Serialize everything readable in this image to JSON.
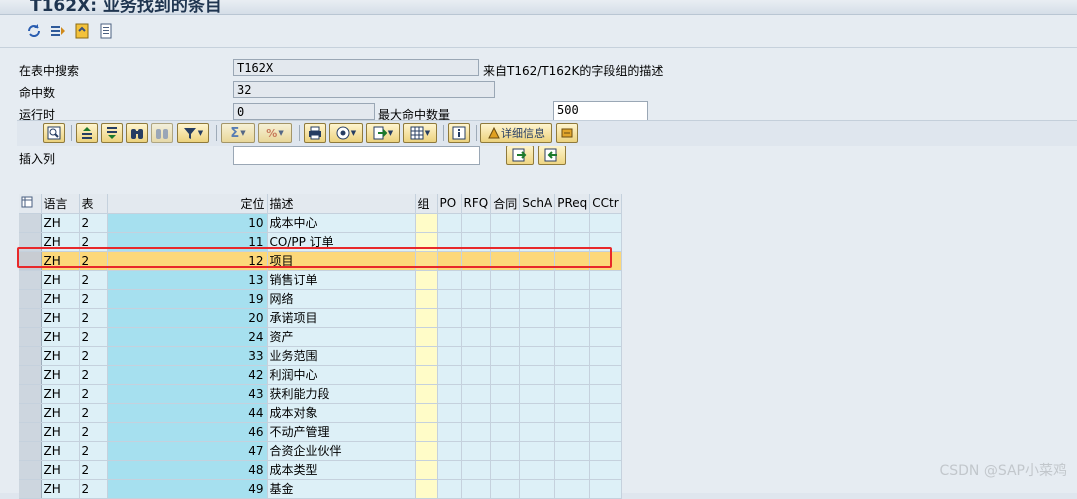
{
  "window": {
    "title": "T162X: 业务找到的条目"
  },
  "toolbar": {
    "icons": [
      "refresh-icon",
      "fieldlist-icon",
      "mark-icon",
      "documentation-icon"
    ]
  },
  "selection": {
    "search_label": "在表中搜索",
    "search_value": "T162X",
    "search_desc": "来自T162/T162K的字段组的描述",
    "hits_label": "命中数",
    "hits_value": "32",
    "runtime_label": "运行时",
    "runtime_value": "0",
    "maxhits_label": "最大命中数量",
    "maxhits_value": "500",
    "insert_col_label": "插入列",
    "insert_col_value": ""
  },
  "alv_toolbar": {
    "details_label": "详细信息"
  },
  "grid": {
    "columns": [
      "语言",
      "表",
      "定位",
      "描述",
      "组",
      "PO",
      "RFQ",
      "合同",
      "SchA",
      "PReq",
      "CCtr"
    ],
    "rows": [
      {
        "lang": "ZH",
        "tab": "2",
        "pos": "10",
        "desc": "成本中心"
      },
      {
        "lang": "ZH",
        "tab": "2",
        "pos": "11",
        "desc": "CO/PP 订单"
      },
      {
        "lang": "ZH",
        "tab": "2",
        "pos": "12",
        "desc": "项目"
      },
      {
        "lang": "ZH",
        "tab": "2",
        "pos": "13",
        "desc": "销售订单"
      },
      {
        "lang": "ZH",
        "tab": "2",
        "pos": "19",
        "desc": "网络"
      },
      {
        "lang": "ZH",
        "tab": "2",
        "pos": "20",
        "desc": "承诺项目"
      },
      {
        "lang": "ZH",
        "tab": "2",
        "pos": "24",
        "desc": "资产"
      },
      {
        "lang": "ZH",
        "tab": "2",
        "pos": "33",
        "desc": "业务范围"
      },
      {
        "lang": "ZH",
        "tab": "2",
        "pos": "42",
        "desc": "利润中心"
      },
      {
        "lang": "ZH",
        "tab": "2",
        "pos": "43",
        "desc": "获利能力段"
      },
      {
        "lang": "ZH",
        "tab": "2",
        "pos": "44",
        "desc": "成本对象"
      },
      {
        "lang": "ZH",
        "tab": "2",
        "pos": "46",
        "desc": "不动产管理"
      },
      {
        "lang": "ZH",
        "tab": "2",
        "pos": "47",
        "desc": "合资企业伙伴"
      },
      {
        "lang": "ZH",
        "tab": "2",
        "pos": "48",
        "desc": "成本类型"
      },
      {
        "lang": "ZH",
        "tab": "2",
        "pos": "49",
        "desc": "基金"
      }
    ],
    "highlighted_row": 2
  },
  "watermark": "CSDN @SAP小菜鸡",
  "colors": {
    "highlight": "#fcd87a",
    "red_frame": "#e8282a",
    "key_blue": "#a6e0ef"
  }
}
